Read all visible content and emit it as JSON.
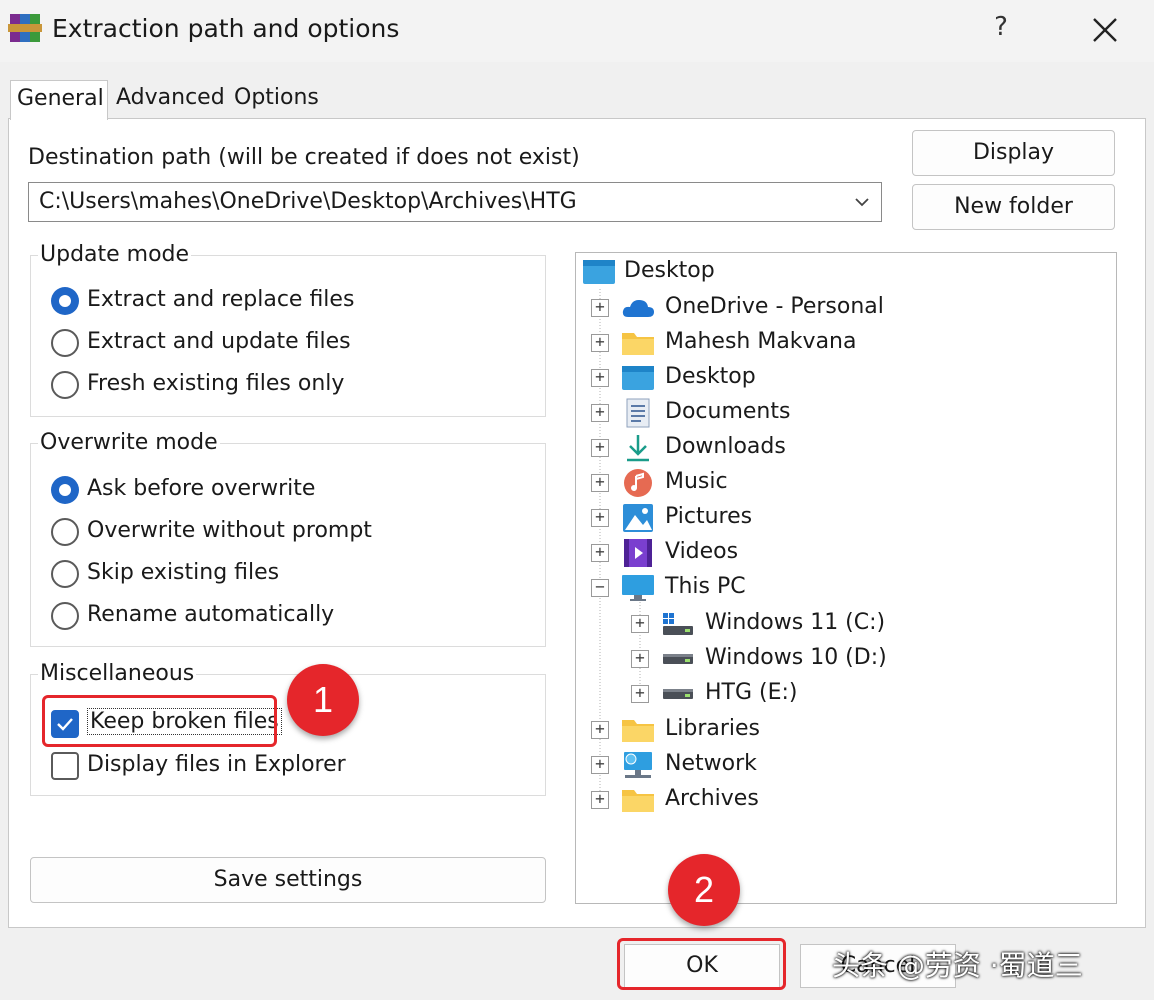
{
  "window": {
    "title": "Extraction path and options",
    "help_label": "?",
    "close_icon": "close-icon",
    "app_icon": "winrar-icon"
  },
  "tabs": [
    {
      "label": "General",
      "selected": true
    },
    {
      "label": "Advanced",
      "selected": false
    },
    {
      "label": "Options",
      "selected": false
    }
  ],
  "destination": {
    "label": "Destination path (will be created if does not exist)",
    "value": "C:\\Users\\mahes\\OneDrive\\Desktop\\Archives\\HTG"
  },
  "buttons": {
    "display": "Display",
    "new_folder": "New folder",
    "save_settings": "Save settings",
    "ok": "OK",
    "cancel": "Cancel"
  },
  "update_mode": {
    "title": "Update mode",
    "options": [
      {
        "label": "Extract and replace files",
        "selected": true
      },
      {
        "label": "Extract and update files",
        "selected": false
      },
      {
        "label": "Fresh existing files only",
        "selected": false
      }
    ]
  },
  "overwrite_mode": {
    "title": "Overwrite mode",
    "options": [
      {
        "label": "Ask before overwrite",
        "selected": true
      },
      {
        "label": "Overwrite without prompt",
        "selected": false
      },
      {
        "label": "Skip existing files",
        "selected": false
      },
      {
        "label": "Rename automatically",
        "selected": false
      }
    ]
  },
  "miscellaneous": {
    "title": "Miscellaneous",
    "options": [
      {
        "label": "Keep broken files",
        "checked": true
      },
      {
        "label": "Display files in Explorer",
        "checked": false
      }
    ]
  },
  "tree": {
    "root": {
      "label": "Desktop",
      "icon": "desktop-icon"
    },
    "items": [
      {
        "label": "OneDrive - Personal",
        "icon": "cloud-icon",
        "expander": "+"
      },
      {
        "label": "Mahesh Makvana",
        "icon": "folder-icon",
        "expander": "+"
      },
      {
        "label": "Desktop",
        "icon": "desktop-folder-icon",
        "expander": "+"
      },
      {
        "label": "Documents",
        "icon": "documents-icon",
        "expander": "+"
      },
      {
        "label": "Downloads",
        "icon": "download-icon",
        "expander": "+"
      },
      {
        "label": "Music",
        "icon": "music-icon",
        "expander": "+"
      },
      {
        "label": "Pictures",
        "icon": "pictures-icon",
        "expander": "+"
      },
      {
        "label": "Videos",
        "icon": "videos-icon",
        "expander": "+"
      },
      {
        "label": "This PC",
        "icon": "monitor-icon",
        "expander": "−"
      }
    ],
    "drives": [
      {
        "label": "Windows 11 (C:)",
        "icon": "windows-drive-icon",
        "expander": "+"
      },
      {
        "label": "Windows 10 (D:)",
        "icon": "drive-icon",
        "expander": "+"
      },
      {
        "label": "HTG (E:)",
        "icon": "drive-icon",
        "expander": "+"
      }
    ],
    "bottom_items": [
      {
        "label": "Libraries",
        "icon": "folder-icon",
        "expander": "+"
      },
      {
        "label": "Network",
        "icon": "network-icon",
        "expander": "+"
      },
      {
        "label": "Archives",
        "icon": "folder-icon",
        "expander": "+"
      }
    ]
  },
  "annotations": {
    "badge_1": "1",
    "badge_2": "2",
    "highlight_color": "#e5262b"
  },
  "watermark": "头条 @劳资 ·蜀道三",
  "colors": {
    "accent": "#1f66c7",
    "folder": "#f6c443"
  }
}
